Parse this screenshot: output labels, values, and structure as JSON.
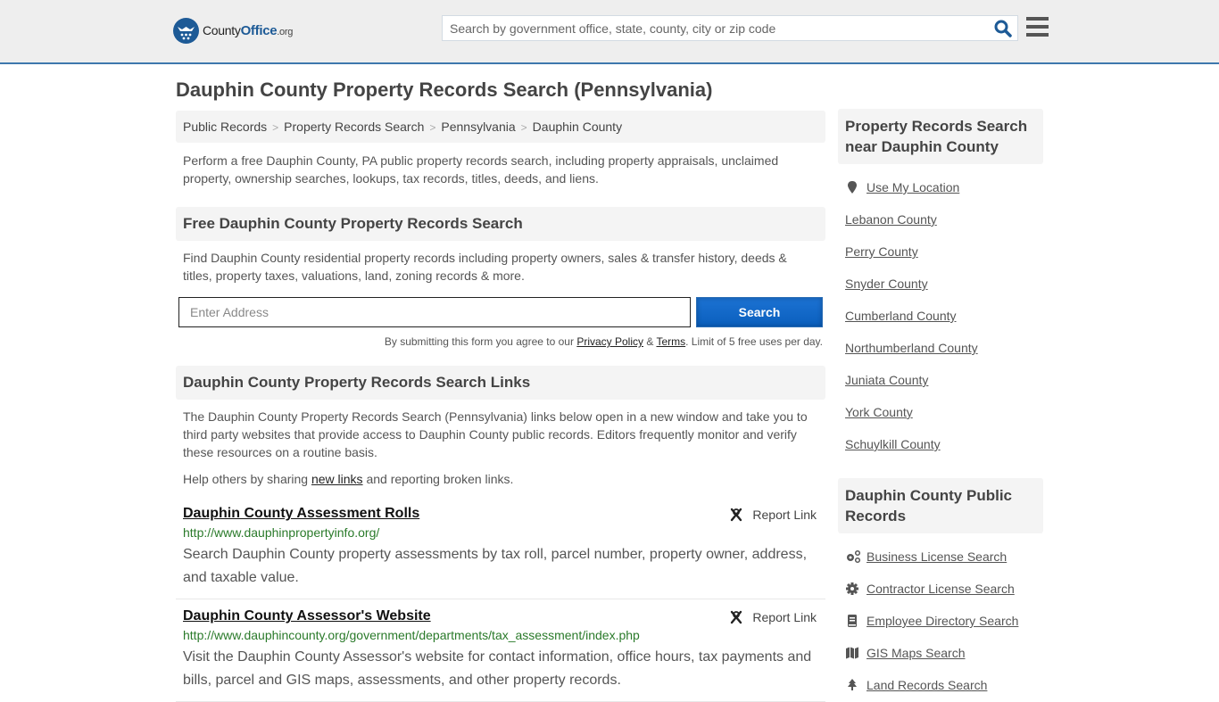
{
  "header": {
    "logo": {
      "county": "County",
      "office": "Office",
      "org": ".org"
    },
    "search_placeholder": "Search by government office, state, county, city or zip code"
  },
  "page_title": "Dauphin County Property Records Search (Pennsylvania)",
  "breadcrumb": [
    "Public Records",
    "Property Records Search",
    "Pennsylvania",
    "Dauphin County"
  ],
  "intro": "Perform a free Dauphin County, PA public property records search, including property appraisals, unclaimed property, ownership searches, lookups, tax records, titles, deeds, and liens.",
  "free_search": {
    "heading": "Free Dauphin County Property Records Search",
    "description": "Find Dauphin County residential property records including property owners, sales & transfer history, deeds & titles, property taxes, valuations, land, zoning records & more.",
    "address_placeholder": "Enter Address",
    "button_label": "Search",
    "disclaimer": {
      "prefix": "By submitting this form you agree to our ",
      "privacy": "Privacy Policy",
      "amp": " & ",
      "terms": "Terms",
      "suffix": ". Limit of 5 free uses per day."
    }
  },
  "links_section": {
    "heading": "Dauphin County Property Records Search Links",
    "description": "The Dauphin County Property Records Search (Pennsylvania) links below open in a new window and take you to third party websites that provide access to Dauphin County public records. Editors frequently monitor and verify these resources on a routine basis.",
    "help": {
      "prefix": "Help others by sharing ",
      "link": "new links",
      "suffix": " and reporting broken links."
    },
    "report_label": "Report Link",
    "records": [
      {
        "title": "Dauphin County Assessment Rolls",
        "url": "http://www.dauphinpropertyinfo.org/",
        "description": "Search Dauphin County property assessments by tax roll, parcel number, property owner, address, and taxable value."
      },
      {
        "title": "Dauphin County Assessor's Website",
        "url": "http://www.dauphincounty.org/government/departments/tax_assessment/index.php",
        "description": "Visit the Dauphin County Assessor's website for contact information, office hours, tax payments and bills, parcel and GIS maps, assessments, and other property records."
      }
    ]
  },
  "sidebar": {
    "nearby": {
      "heading": "Property Records Search near Dauphin County",
      "use_location": "Use My Location",
      "counties": [
        "Lebanon County",
        "Perry County",
        "Snyder County",
        "Cumberland County",
        "Northumberland County",
        "Juniata County",
        "York County",
        "Schuylkill County"
      ]
    },
    "public_records": {
      "heading": "Dauphin County Public Records",
      "items": [
        {
          "label": "Business License Search",
          "icon": "cogs-icon"
        },
        {
          "label": "Contractor License Search",
          "icon": "gear-icon"
        },
        {
          "label": "Employee Directory Search",
          "icon": "book-icon"
        },
        {
          "label": "GIS Maps Search",
          "icon": "map-icon"
        },
        {
          "label": "Land Records Search",
          "icon": "tree-icon"
        }
      ]
    }
  }
}
